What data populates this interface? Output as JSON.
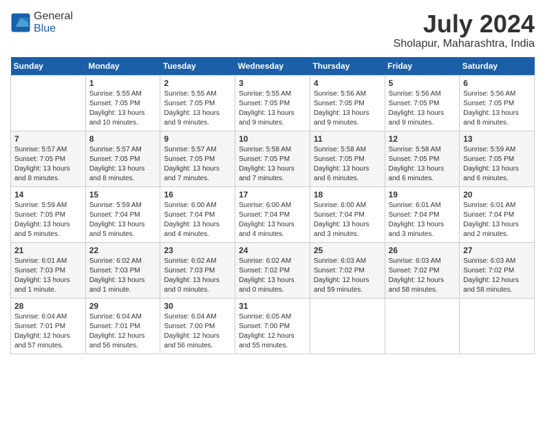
{
  "header": {
    "logo_general": "General",
    "logo_blue": "Blue",
    "month_year": "July 2024",
    "location": "Sholapur, Maharashtra, India"
  },
  "days_of_week": [
    "Sunday",
    "Monday",
    "Tuesday",
    "Wednesday",
    "Thursday",
    "Friday",
    "Saturday"
  ],
  "weeks": [
    [
      {
        "day": "",
        "info": ""
      },
      {
        "day": "1",
        "info": "Sunrise: 5:55 AM\nSunset: 7:05 PM\nDaylight: 13 hours\nand 10 minutes."
      },
      {
        "day": "2",
        "info": "Sunrise: 5:55 AM\nSunset: 7:05 PM\nDaylight: 13 hours\nand 9 minutes."
      },
      {
        "day": "3",
        "info": "Sunrise: 5:55 AM\nSunset: 7:05 PM\nDaylight: 13 hours\nand 9 minutes."
      },
      {
        "day": "4",
        "info": "Sunrise: 5:56 AM\nSunset: 7:05 PM\nDaylight: 13 hours\nand 9 minutes."
      },
      {
        "day": "5",
        "info": "Sunrise: 5:56 AM\nSunset: 7:05 PM\nDaylight: 13 hours\nand 9 minutes."
      },
      {
        "day": "6",
        "info": "Sunrise: 5:56 AM\nSunset: 7:05 PM\nDaylight: 13 hours\nand 8 minutes."
      }
    ],
    [
      {
        "day": "7",
        "info": "Sunrise: 5:57 AM\nSunset: 7:05 PM\nDaylight: 13 hours\nand 8 minutes."
      },
      {
        "day": "8",
        "info": "Sunrise: 5:57 AM\nSunset: 7:05 PM\nDaylight: 13 hours\nand 8 minutes."
      },
      {
        "day": "9",
        "info": "Sunrise: 5:57 AM\nSunset: 7:05 PM\nDaylight: 13 hours\nand 7 minutes."
      },
      {
        "day": "10",
        "info": "Sunrise: 5:58 AM\nSunset: 7:05 PM\nDaylight: 13 hours\nand 7 minutes."
      },
      {
        "day": "11",
        "info": "Sunrise: 5:58 AM\nSunset: 7:05 PM\nDaylight: 13 hours\nand 6 minutes."
      },
      {
        "day": "12",
        "info": "Sunrise: 5:58 AM\nSunset: 7:05 PM\nDaylight: 13 hours\nand 6 minutes."
      },
      {
        "day": "13",
        "info": "Sunrise: 5:59 AM\nSunset: 7:05 PM\nDaylight: 13 hours\nand 6 minutes."
      }
    ],
    [
      {
        "day": "14",
        "info": "Sunrise: 5:59 AM\nSunset: 7:05 PM\nDaylight: 13 hours\nand 5 minutes."
      },
      {
        "day": "15",
        "info": "Sunrise: 5:59 AM\nSunset: 7:04 PM\nDaylight: 13 hours\nand 5 minutes."
      },
      {
        "day": "16",
        "info": "Sunrise: 6:00 AM\nSunset: 7:04 PM\nDaylight: 13 hours\nand 4 minutes."
      },
      {
        "day": "17",
        "info": "Sunrise: 6:00 AM\nSunset: 7:04 PM\nDaylight: 13 hours\nand 4 minutes."
      },
      {
        "day": "18",
        "info": "Sunrise: 6:00 AM\nSunset: 7:04 PM\nDaylight: 13 hours\nand 3 minutes."
      },
      {
        "day": "19",
        "info": "Sunrise: 6:01 AM\nSunset: 7:04 PM\nDaylight: 13 hours\nand 3 minutes."
      },
      {
        "day": "20",
        "info": "Sunrise: 6:01 AM\nSunset: 7:04 PM\nDaylight: 13 hours\nand 2 minutes."
      }
    ],
    [
      {
        "day": "21",
        "info": "Sunrise: 6:01 AM\nSunset: 7:03 PM\nDaylight: 13 hours\nand 1 minute."
      },
      {
        "day": "22",
        "info": "Sunrise: 6:02 AM\nSunset: 7:03 PM\nDaylight: 13 hours\nand 1 minute."
      },
      {
        "day": "23",
        "info": "Sunrise: 6:02 AM\nSunset: 7:03 PM\nDaylight: 13 hours\nand 0 minutes."
      },
      {
        "day": "24",
        "info": "Sunrise: 6:02 AM\nSunset: 7:02 PM\nDaylight: 13 hours\nand 0 minutes."
      },
      {
        "day": "25",
        "info": "Sunrise: 6:03 AM\nSunset: 7:02 PM\nDaylight: 12 hours\nand 59 minutes."
      },
      {
        "day": "26",
        "info": "Sunrise: 6:03 AM\nSunset: 7:02 PM\nDaylight: 12 hours\nand 58 minutes."
      },
      {
        "day": "27",
        "info": "Sunrise: 6:03 AM\nSunset: 7:02 PM\nDaylight: 12 hours\nand 58 minutes."
      }
    ],
    [
      {
        "day": "28",
        "info": "Sunrise: 6:04 AM\nSunset: 7:01 PM\nDaylight: 12 hours\nand 57 minutes."
      },
      {
        "day": "29",
        "info": "Sunrise: 6:04 AM\nSunset: 7:01 PM\nDaylight: 12 hours\nand 56 minutes."
      },
      {
        "day": "30",
        "info": "Sunrise: 6:04 AM\nSunset: 7:00 PM\nDaylight: 12 hours\nand 56 minutes."
      },
      {
        "day": "31",
        "info": "Sunrise: 6:05 AM\nSunset: 7:00 PM\nDaylight: 12 hours\nand 55 minutes."
      },
      {
        "day": "",
        "info": ""
      },
      {
        "day": "",
        "info": ""
      },
      {
        "day": "",
        "info": ""
      }
    ]
  ]
}
